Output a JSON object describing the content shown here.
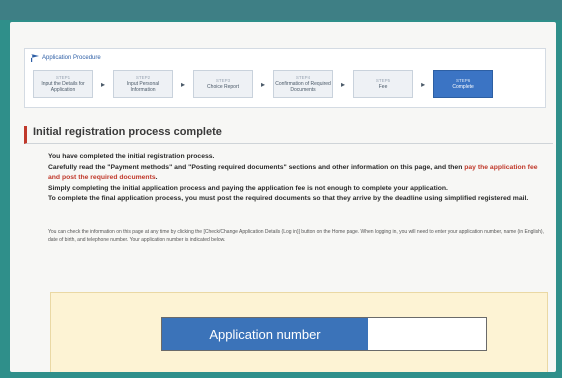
{
  "procedure": {
    "title": "Application Procedure",
    "steps": [
      {
        "num": "STEP1",
        "label": "Input the Details for Application"
      },
      {
        "num": "STEP2",
        "label": "Input Personal Information"
      },
      {
        "num": "STEP3",
        "label": "Choice Report"
      },
      {
        "num": "STEP4",
        "label": "Confirmation of Required Documents"
      },
      {
        "num": "STEP5",
        "label": "Fee"
      },
      {
        "num": "STEP6",
        "label": "Complete"
      }
    ]
  },
  "section": {
    "title": "Initial registration process complete"
  },
  "message": {
    "p1": "You have completed the initial registration process.",
    "p2_a": "Carefully read the \"Payment methods\" and \"Posting required documents\" sections and other information on this page, and then ",
    "p2_red": "pay the application fee and post the required documents",
    "p2_b": ".",
    "p3": "Simply completing the initial application process and paying the application fee is not enough to complete your application.",
    "p4": "To complete the final application process, you must post the required documents so that they arrive by the deadline using simplified registered mail."
  },
  "note": "You can check the information on this page at any time by clicking the [Check/Change Application Details (Log in)] button on the Home page. When logging in, you will need to enter your application number, name (in English), date of birth, and telephone number. Your application number is indicated below.",
  "application_number": {
    "label": "Application number",
    "value": ""
  },
  "colors": {
    "accent": "#3b73b9",
    "alert": "#c0392b",
    "panel": "#fdf3d4",
    "frame": "#2f8f8a"
  }
}
